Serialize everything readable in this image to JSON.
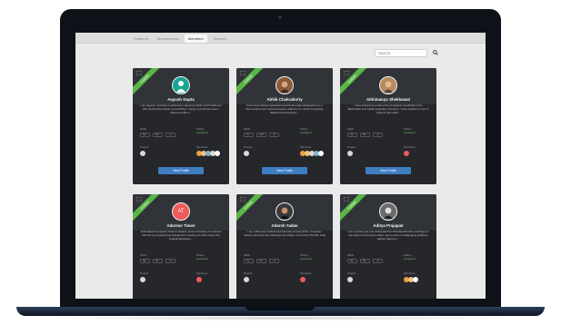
{
  "nav": {
    "tabs": [
      {
        "label": "Featured"
      },
      {
        "label": "Memberships"
      },
      {
        "label": "Members",
        "active": true
      },
      {
        "label": "Mentors"
      }
    ]
  },
  "search": {
    "placeholder": "Search"
  },
  "labels": {
    "skills": "Skills",
    "status": "Status",
    "project": "Project",
    "members": "Members",
    "view_profile": "View Profile",
    "ribbon": "Available"
  },
  "cards": [
    {
      "name": "Aayush Gupta",
      "desc": "I am Aayush, currently a sophomore majoring in ECE at IIIT Delhi and Ubix Student Developer at GoodVibes. Trying my freshman year, I discovered life a...",
      "skills": [
        "Ba..",
        "Bo..",
        "+1"
      ],
      "status": "Accepted",
      "avatar": "teal-person"
    },
    {
      "name": "Abhik Chakraborty",
      "desc": "I have been always dedicated towards the tasks assigned to me. I have worked upon various projects related to AI, Cloud Computing, Backend development...",
      "skills": [
        "Py..",
        "API",
        "+5"
      ],
      "status": "Accepted",
      "avatar": "photo"
    },
    {
      "name": "Abhimanyu Shekhawat",
      "desc": "I have worked on a wide array of projects specifically in the Blockchain and mobile application domains. I have worked on a lot of projects that enabl...",
      "skills": [
        "Ap..",
        "Ba..",
        "+4"
      ],
      "status": "Accepted",
      "avatar": "photo"
    },
    {
      "name": "Adarsse Tiwari",
      "desc": "Enthusiastic Computer Science student, at the University of Lucknow with strong programming background. Leading the Team Grow The Coastal Reduction...",
      "skills": [
        "Ba..",
        "Bo..",
        "+1"
      ],
      "status": "Accepted",
      "avatar": "initials",
      "initials": "AT"
    },
    {
      "name": "Adarsh Yadav",
      "desc": "I am a final year student and currently pursuing B.Sc. Computer Science (Honors) from Hansraj Law college I University Of Delhi, India",
      "skills": [
        "Py..",
        "UX..",
        "+2"
      ],
      "status": "Accepted",
      "avatar": "photo"
    },
    {
      "name": "Aditya Prajapati",
      "desc": "I am a senior year one undergrad from Mumbai who likes working in a fast paced environment where i get to work on challenging problems without having m...",
      "skills": [
        "Ba..",
        "Bo..",
        "+1"
      ],
      "status": "Accepted",
      "avatar": "photo"
    }
  ]
}
